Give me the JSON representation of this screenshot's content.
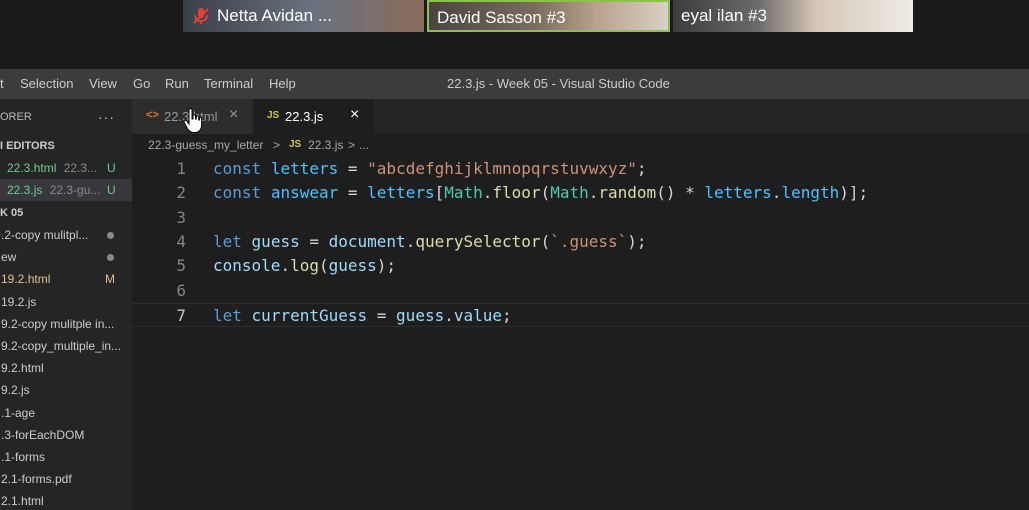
{
  "zoom": {
    "participants": [
      {
        "name": "Netta Avidan ...",
        "muted": true
      },
      {
        "name": "David Sasson #3",
        "active_speaker": true
      },
      {
        "name": "eyal ilan #3"
      }
    ]
  },
  "menubar": {
    "items": [
      "t",
      "Selection",
      "View",
      "Go",
      "Run",
      "Terminal",
      "Help"
    ],
    "window_title": "22.3.js - Week 05 - Visual Studio Code"
  },
  "sidebar": {
    "title": "ORER",
    "open_editors_header": "I EDITORS",
    "open_editors": [
      {
        "label": "22.3.html",
        "hint": "22.3...",
        "badge": "U"
      },
      {
        "label": "22.3.js",
        "hint": "22.3-gu...",
        "badge": "U"
      }
    ],
    "folder_header": "K 05",
    "files": [
      {
        "label": ".2-copy mulitpl...",
        "status": "dot"
      },
      {
        "label": "ew",
        "status": "dot"
      },
      {
        "label": "19.2.html",
        "status": "M"
      },
      {
        "label": "19.2.js",
        "status": ""
      },
      {
        "label": "9.2-copy mulitple in...",
        "status": ""
      },
      {
        "label": "9.2-copy_multiple_in...",
        "status": ""
      },
      {
        "label": "9.2.html",
        "status": ""
      },
      {
        "label": "9.2.js",
        "status": ""
      },
      {
        "label": ".1-age",
        "status": ""
      },
      {
        "label": ".3-forEachDOM",
        "status": ""
      },
      {
        "label": ".1-forms",
        "status": ""
      },
      {
        "label": "2.1-forms.pdf",
        "status": ""
      },
      {
        "label": "2.1.html",
        "status": ""
      }
    ]
  },
  "tabs": [
    {
      "icon": "<>",
      "label": "22.3.html",
      "close": "×",
      "active": false
    },
    {
      "icon": "JS",
      "label": "22.3.js",
      "close": "×",
      "active": true
    }
  ],
  "breadcrumb": {
    "folder": "22.3-guess_my_letter",
    "sep": ">",
    "js_icon": "JS",
    "file": "22.3.js",
    "sep2": ">",
    "tail": "..."
  },
  "editor": {
    "current_line": 7,
    "lines": [
      {
        "n": "1",
        "tokens": [
          {
            "t": "const",
            "c": "kw"
          },
          {
            "t": " ",
            "c": "pn"
          },
          {
            "t": "letters",
            "c": "var"
          },
          {
            "t": " = ",
            "c": "pn"
          },
          {
            "t": "\"abcdefghijklmnopqrstuvwxyz\"",
            "c": "str"
          },
          {
            "t": ";",
            "c": "pn"
          }
        ]
      },
      {
        "n": "2",
        "tokens": [
          {
            "t": "const",
            "c": "kw"
          },
          {
            "t": " ",
            "c": "pn"
          },
          {
            "t": "answear",
            "c": "var"
          },
          {
            "t": " = ",
            "c": "pn"
          },
          {
            "t": "letters",
            "c": "var"
          },
          {
            "t": "[",
            "c": "pn"
          },
          {
            "t": "Math",
            "c": "cls"
          },
          {
            "t": ".",
            "c": "pn"
          },
          {
            "t": "floor",
            "c": "fn"
          },
          {
            "t": "(",
            "c": "pn"
          },
          {
            "t": "Math",
            "c": "cls"
          },
          {
            "t": ".",
            "c": "pn"
          },
          {
            "t": "random",
            "c": "fn"
          },
          {
            "t": "() * ",
            "c": "pn"
          },
          {
            "t": "letters",
            "c": "var"
          },
          {
            "t": ".",
            "c": "pn"
          },
          {
            "t": "length",
            "c": "var"
          },
          {
            "t": ")];",
            "c": "pn"
          }
        ]
      },
      {
        "n": "3",
        "tokens": []
      },
      {
        "n": "4",
        "tokens": [
          {
            "t": "let",
            "c": "kw"
          },
          {
            "t": " ",
            "c": "pn"
          },
          {
            "t": "guess",
            "c": "vv"
          },
          {
            "t": " = ",
            "c": "pn"
          },
          {
            "t": "document",
            "c": "vv"
          },
          {
            "t": ".",
            "c": "pn"
          },
          {
            "t": "querySelector",
            "c": "fn"
          },
          {
            "t": "(",
            "c": "pn"
          },
          {
            "t": "`.guess`",
            "c": "str"
          },
          {
            "t": ");",
            "c": "pn"
          }
        ]
      },
      {
        "n": "5",
        "tokens": [
          {
            "t": "console",
            "c": "vv"
          },
          {
            "t": ".",
            "c": "pn"
          },
          {
            "t": "log",
            "c": "fn"
          },
          {
            "t": "(",
            "c": "pn"
          },
          {
            "t": "guess",
            "c": "vv"
          },
          {
            "t": ");",
            "c": "pn"
          }
        ]
      },
      {
        "n": "6",
        "tokens": []
      },
      {
        "n": "7",
        "tokens": [
          {
            "t": "let",
            "c": "kw"
          },
          {
            "t": " ",
            "c": "pn"
          },
          {
            "t": "currentGuess",
            "c": "vv"
          },
          {
            "t": " = ",
            "c": "pn"
          },
          {
            "t": "guess",
            "c": "vv"
          },
          {
            "t": ".",
            "c": "pn"
          },
          {
            "t": "value",
            "c": "vv"
          },
          {
            "t": ";",
            "c": "pn"
          }
        ]
      }
    ]
  },
  "colors": {
    "accent_speaker": "#8bc34a",
    "git_untracked": "#73c991",
    "git_modified": "#e2c08d"
  }
}
